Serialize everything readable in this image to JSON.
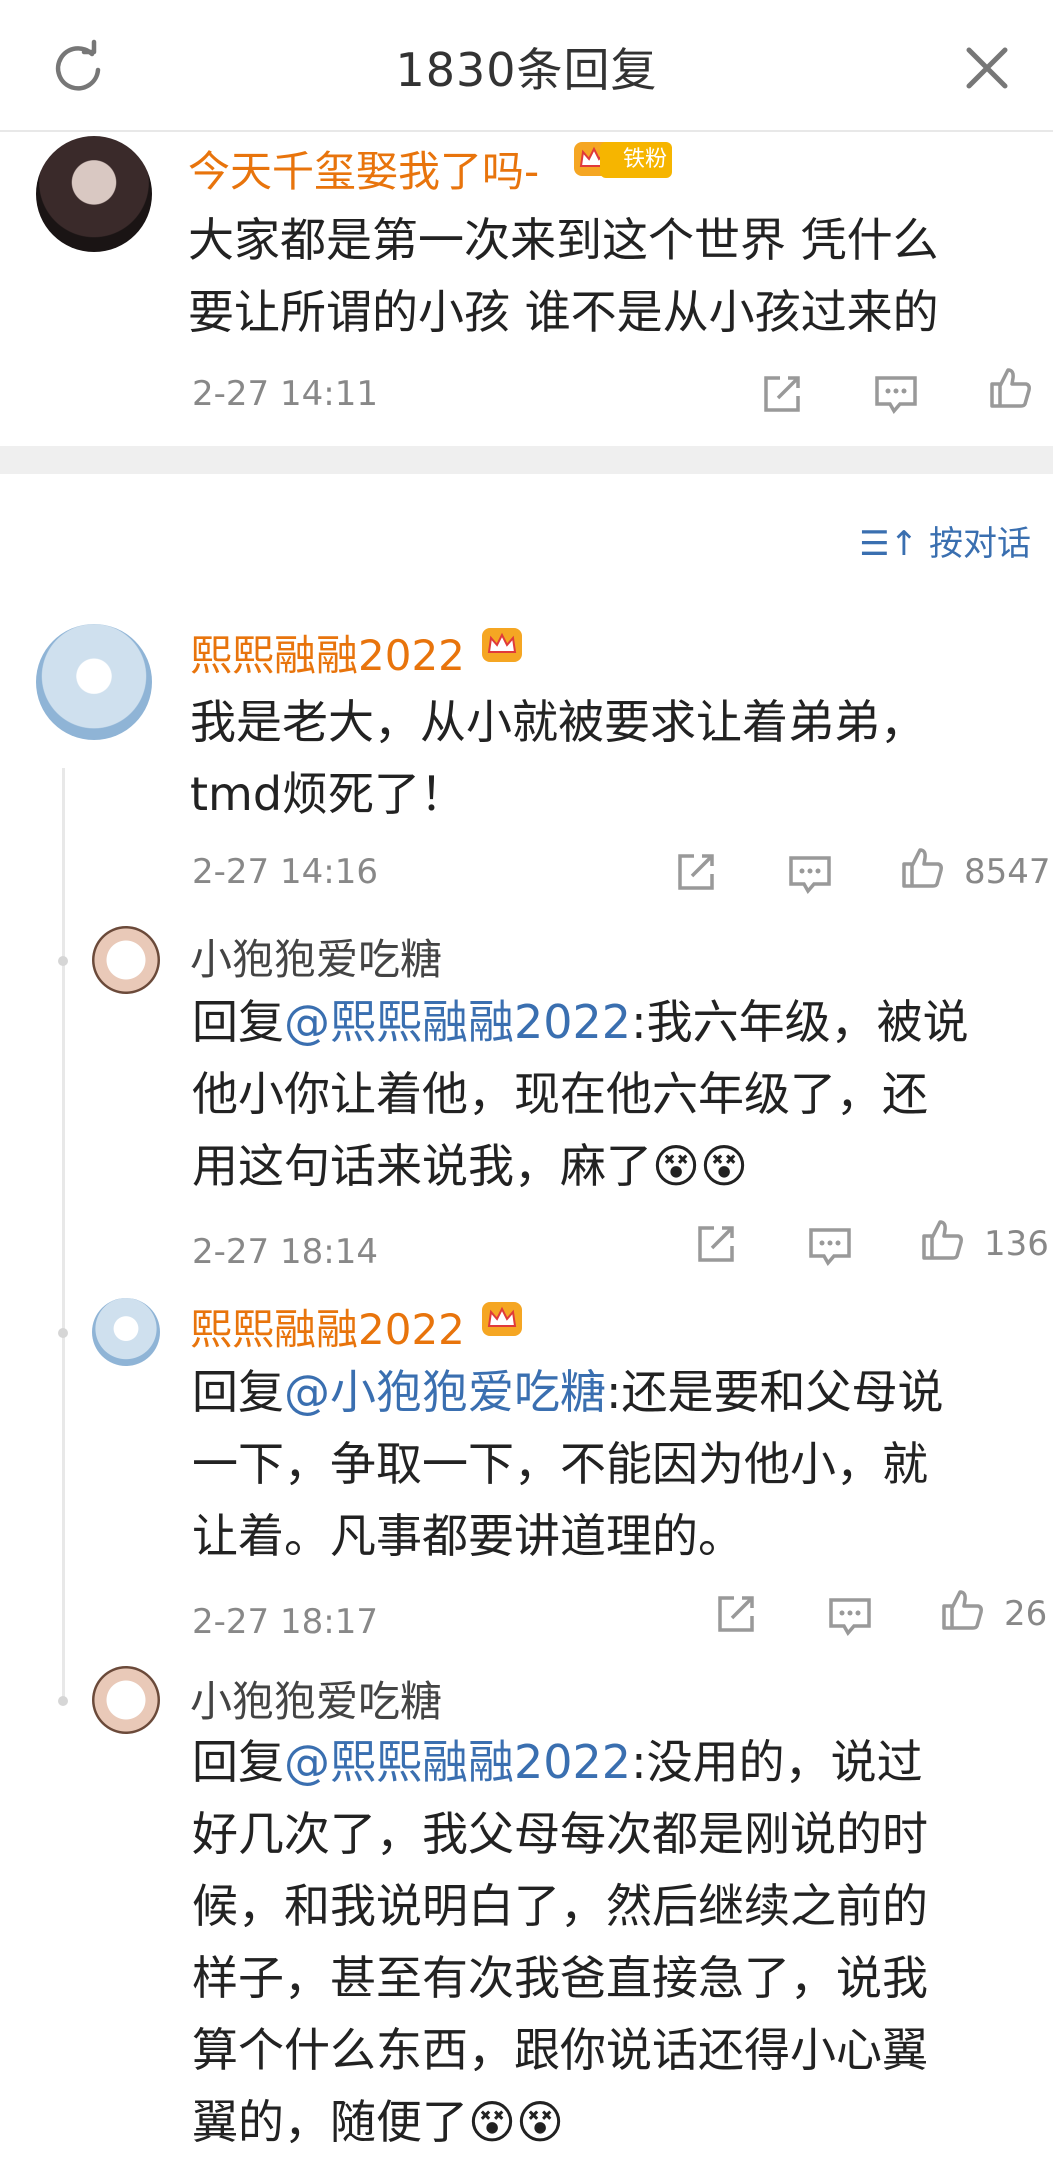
{
  "header": {
    "title": "1830条回复"
  },
  "root": {
    "name": "今天千玺娶我了吗-",
    "badge": "铁粉",
    "text_line1": "大家都是第一次来到这个世界 凭什么",
    "text_line2": "要让所谓的小孩 谁不是从小孩过来的",
    "time": "2-27 14:11"
  },
  "sort_label": "按对话",
  "comments": [
    {
      "name": "熙熙融融2022",
      "line1": "我是老大，从小就被要求让着弟弟，",
      "line2": "tmd烦死了！",
      "time": "2-27 14:16",
      "likes": "8547"
    },
    {
      "name": "小狍狍爱吃糖",
      "reply_prefix": "回复",
      "mention": "@熙熙融融2022",
      "line1_rest": ":我六年级，被说",
      "line2": "他小你让着他，现在他六年级了，还",
      "line3": "用这句话来说我，麻了",
      "time": "2-27 18:14",
      "likes": "136"
    },
    {
      "name": "熙熙融融2022",
      "reply_prefix": "回复",
      "mention": "@小狍狍爱吃糖",
      "line1_rest": ":还是要和父母说",
      "line2": "一下，争取一下，不能因为他小，就",
      "line3": "让着。凡事都要讲道理的。",
      "time": "2-27 18:17",
      "likes": "26"
    },
    {
      "name": "小狍狍爱吃糖",
      "reply_prefix": "回复",
      "mention": "@熙熙融融2022",
      "line1_rest": ":没用的，说过",
      "line2": "好几次了，我父母每次都是刚说的时",
      "line3": "候，和我说明白了，然后继续之前的",
      "line4": "样子，甚至有次我爸直接急了，说我",
      "line5": "算个什么东西，跟你说话还得小心翼",
      "line6": "翼的，随便了"
    }
  ],
  "colors": {
    "accent_orange": "#e8740c",
    "mention_blue": "#3a6fb0",
    "meta_gray": "#888888"
  }
}
